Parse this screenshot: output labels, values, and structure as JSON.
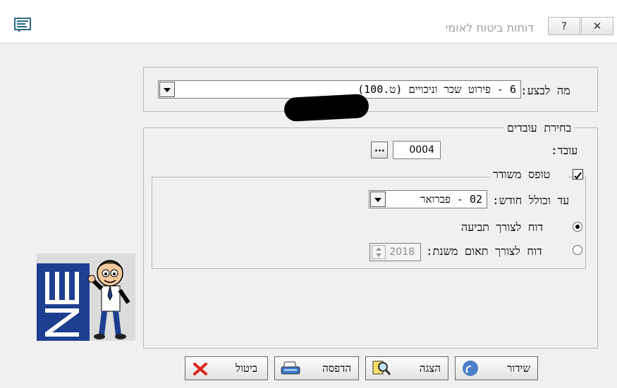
{
  "window": {
    "title": "דוחות ביטוח לאומי",
    "help_button": "?",
    "close_button": "✕"
  },
  "form": {
    "action_label": "מה לבצע:",
    "action_value": "6 - פירוט שכר וניכויים (ט.100)",
    "employees_group_title": "בחירת עובדים",
    "employee_label": "עובד:",
    "employee_value": "0004",
    "employee_lookup_label": "...",
    "printed_form_label": "טופס משודר",
    "printed_form_checked": true,
    "through_month_label": "עד וכולל חודש:",
    "through_month_value": "02 - פברואר",
    "claim_report_label": "דוח לצורך תביעה",
    "reconciliation_report_label": "דוח לצורך תאום משנת:",
    "reconciliation_year": "2018"
  },
  "buttons": {
    "transmit": "שידור",
    "display": "הצגה",
    "print": "הדפסה",
    "cancel": "ביטול"
  }
}
